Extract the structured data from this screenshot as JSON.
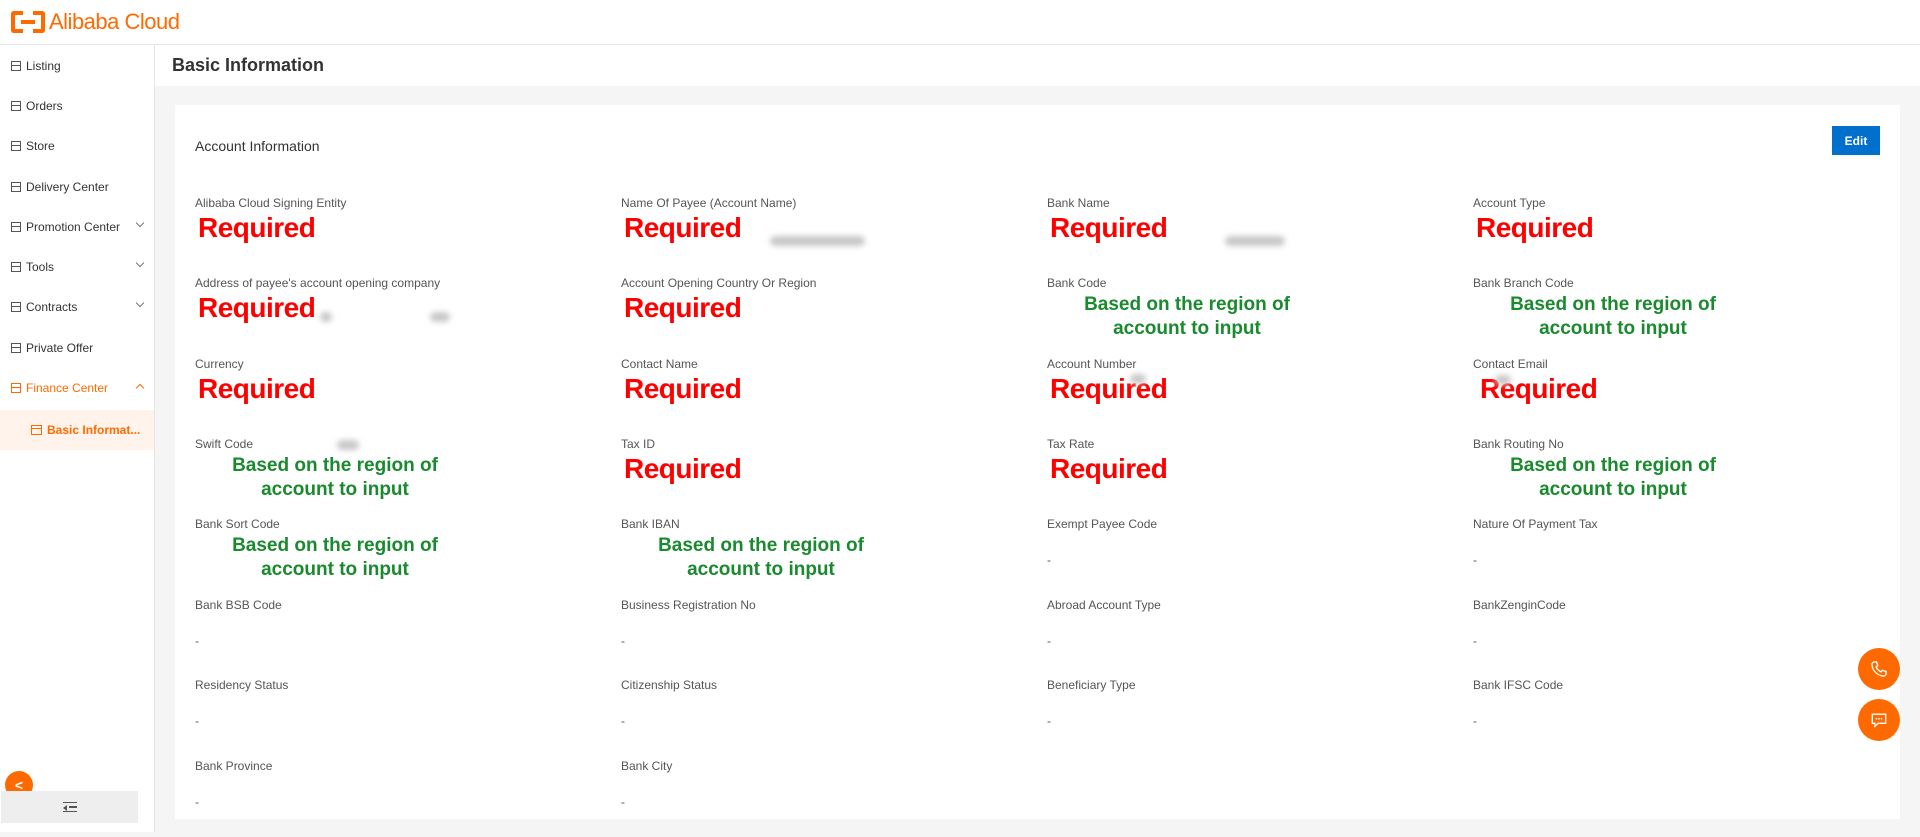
{
  "brand": {
    "name": "Alibaba Cloud",
    "accent": "#ff6a00"
  },
  "sidebar": {
    "items": [
      {
        "label": "Listing",
        "expandable": false
      },
      {
        "label": "Orders",
        "expandable": false
      },
      {
        "label": "Store",
        "expandable": false
      },
      {
        "label": "Delivery Center",
        "expandable": false
      },
      {
        "label": "Promotion Center",
        "expandable": true
      },
      {
        "label": "Tools",
        "expandable": true
      },
      {
        "label": "Contracts",
        "expandable": true
      },
      {
        "label": "Private Offer",
        "expandable": false
      },
      {
        "label": "Finance Center",
        "expandable": true,
        "active": true,
        "expanded": true
      }
    ],
    "sub_item": "Basic Informat...",
    "collapse_glyph": "<"
  },
  "page": {
    "title": "Basic Information"
  },
  "card": {
    "title": "Account Information",
    "edit_label": "Edit",
    "annotations": {
      "required": "Required",
      "region_note": "Based on the region of account to input"
    },
    "fields": [
      {
        "label": "Alibaba Cloud Signing Entity",
        "value": "Required",
        "kind": "required"
      },
      {
        "label": "Name Of Payee (Account Name)",
        "value": "Required",
        "kind": "required"
      },
      {
        "label": "Bank Name",
        "value": "Required",
        "kind": "required"
      },
      {
        "label": "Account Type",
        "value": "Required",
        "kind": "required"
      },
      {
        "label": "Address of payee's account opening company",
        "value": "Required",
        "kind": "required"
      },
      {
        "label": "Account Opening Country Or Region",
        "value": "Required",
        "kind": "required"
      },
      {
        "label": "Bank Code",
        "value": "Based on the region of account to input",
        "kind": "note"
      },
      {
        "label": "Bank Branch Code",
        "value": "Based on the region of account to input",
        "kind": "note"
      },
      {
        "label": "Currency",
        "value": "Required",
        "kind": "required"
      },
      {
        "label": "Contact Name",
        "value": "Required",
        "kind": "required"
      },
      {
        "label": "Account Number",
        "value": "Required",
        "kind": "required"
      },
      {
        "label": "Contact Email",
        "value": "Required",
        "kind": "required"
      },
      {
        "label": "Swift Code",
        "value": "Based on the region of account to input",
        "kind": "note"
      },
      {
        "label": "Tax ID",
        "value": "Required",
        "kind": "required"
      },
      {
        "label": "Tax Rate",
        "value": "Required",
        "kind": "required"
      },
      {
        "label": "Bank Routing No",
        "value": "Based on the region of account to input",
        "kind": "note"
      },
      {
        "label": "Bank Sort Code",
        "value": "Based on the region of account to input",
        "kind": "note"
      },
      {
        "label": "Bank IBAN",
        "value": "Based on the region of account to input",
        "kind": "note"
      },
      {
        "label": "Exempt Payee Code",
        "value": "-",
        "kind": "dash"
      },
      {
        "label": "Nature Of Payment Tax",
        "value": "-",
        "kind": "dash"
      },
      {
        "label": "Bank BSB Code",
        "value": "-",
        "kind": "dash"
      },
      {
        "label": "Business Registration No",
        "value": "-",
        "kind": "dash"
      },
      {
        "label": "Abroad Account Type",
        "value": "-",
        "kind": "dash"
      },
      {
        "label": "BankZenginCode",
        "value": "-",
        "kind": "dash"
      },
      {
        "label": "Residency Status",
        "value": "-",
        "kind": "dash"
      },
      {
        "label": "Citizenship Status",
        "value": "-",
        "kind": "dash"
      },
      {
        "label": "Beneficiary Type",
        "value": "-",
        "kind": "dash"
      },
      {
        "label": "Bank IFSC Code",
        "value": "-",
        "kind": "dash"
      },
      {
        "label": "Bank Province",
        "value": "-",
        "kind": "dash"
      },
      {
        "label": "Bank City",
        "value": "-",
        "kind": "dash"
      }
    ]
  },
  "floating": {
    "phone_icon": "phone-icon",
    "chat_icon": "chat-icon"
  }
}
